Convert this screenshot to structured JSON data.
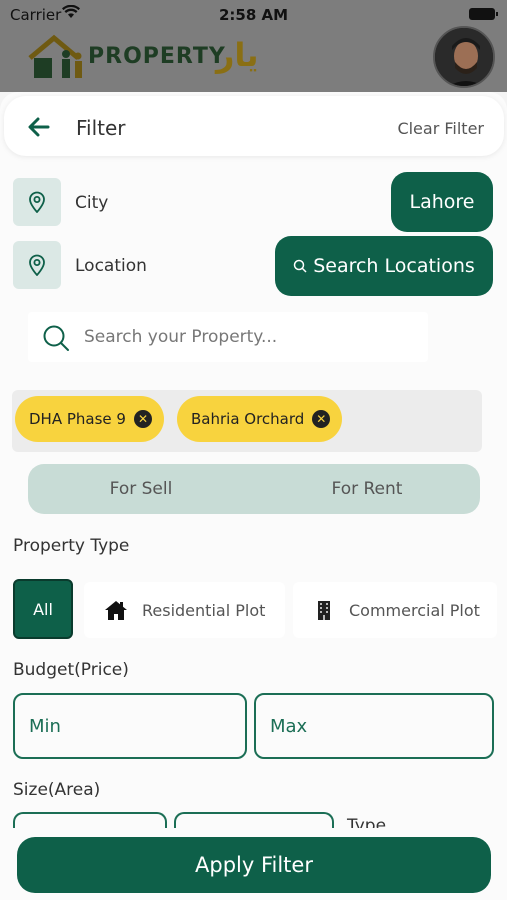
{
  "status_bar": {
    "carrier": "Carrier",
    "time": "2:58 AM"
  },
  "app_header": {
    "logo_text": "PROPERTY",
    "logo_urdu": "یار"
  },
  "header": {
    "title": "Filter",
    "clear_label": "Clear Filter"
  },
  "city": {
    "label": "City",
    "value": "Lahore"
  },
  "location": {
    "label": "Location",
    "button_label": "Search Locations"
  },
  "search": {
    "placeholder": "Search your Property..."
  },
  "selected_locations": [
    "DHA Phase 9",
    "Bahria Orchard"
  ],
  "purpose_tabs": [
    "For Sell",
    "For Rent"
  ],
  "property_type": {
    "heading": "Property Type",
    "options": [
      "All",
      "Residential Plot",
      "Commercial Plot"
    ],
    "selected": "All"
  },
  "budget": {
    "heading": "Budget(Price)",
    "min_placeholder": "Min",
    "max_placeholder": "Max"
  },
  "size": {
    "heading": "Size(Area)",
    "type_label": "Type"
  },
  "apply_label": "Apply Filter",
  "colors": {
    "primary": "#0e6049",
    "chip": "#f8d33e",
    "segment": "#c8dcd6",
    "pin_bg": "#dbe8e5"
  }
}
